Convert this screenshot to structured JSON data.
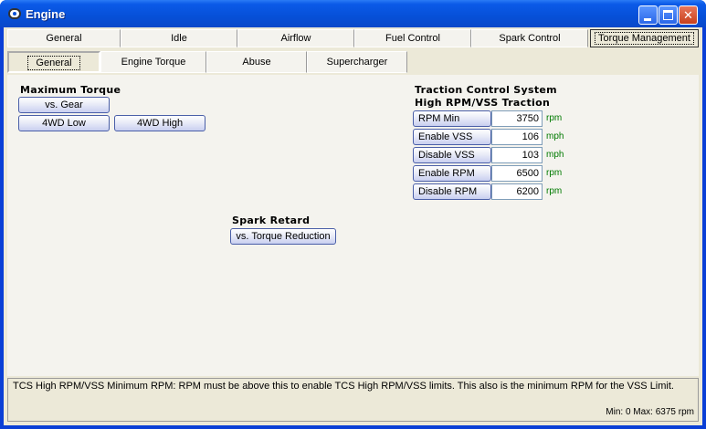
{
  "window": {
    "title": "Engine"
  },
  "tabs": [
    {
      "label": "General"
    },
    {
      "label": "Idle"
    },
    {
      "label": "Airflow"
    },
    {
      "label": "Fuel Control"
    },
    {
      "label": "Spark Control"
    },
    {
      "label": "Torque Management"
    }
  ],
  "subtabs": [
    {
      "label": "General"
    },
    {
      "label": "Engine Torque"
    },
    {
      "label": "Abuse"
    },
    {
      "label": "Supercharger"
    }
  ],
  "max_torque": {
    "title": "Maximum Torque",
    "vs_gear": "vs. Gear",
    "low_4wd": "4WD Low",
    "high_4wd": "4WD High"
  },
  "spark_retard": {
    "title": "Spark Retard",
    "vs_torque_reduction": "vs. Torque Reduction"
  },
  "tcs": {
    "title": "Traction Control System",
    "subtitle": "High RPM/VSS Traction",
    "rows": [
      {
        "label": "RPM Min",
        "value": "3750",
        "unit": "rpm"
      },
      {
        "label": "Enable VSS",
        "value": "106",
        "unit": "mph"
      },
      {
        "label": "Disable VSS",
        "value": "103",
        "unit": "mph"
      },
      {
        "label": "Enable RPM",
        "value": "6500",
        "unit": "rpm"
      },
      {
        "label": "Disable RPM",
        "value": "6200",
        "unit": "rpm"
      }
    ]
  },
  "status": {
    "description": "TCS High RPM/VSS Minimum RPM: RPM must be above this to enable TCS High RPM/VSS limits. This also is the minimum RPM for the VSS Limit.",
    "range": "Min: 0 Max: 6375 rpm"
  }
}
